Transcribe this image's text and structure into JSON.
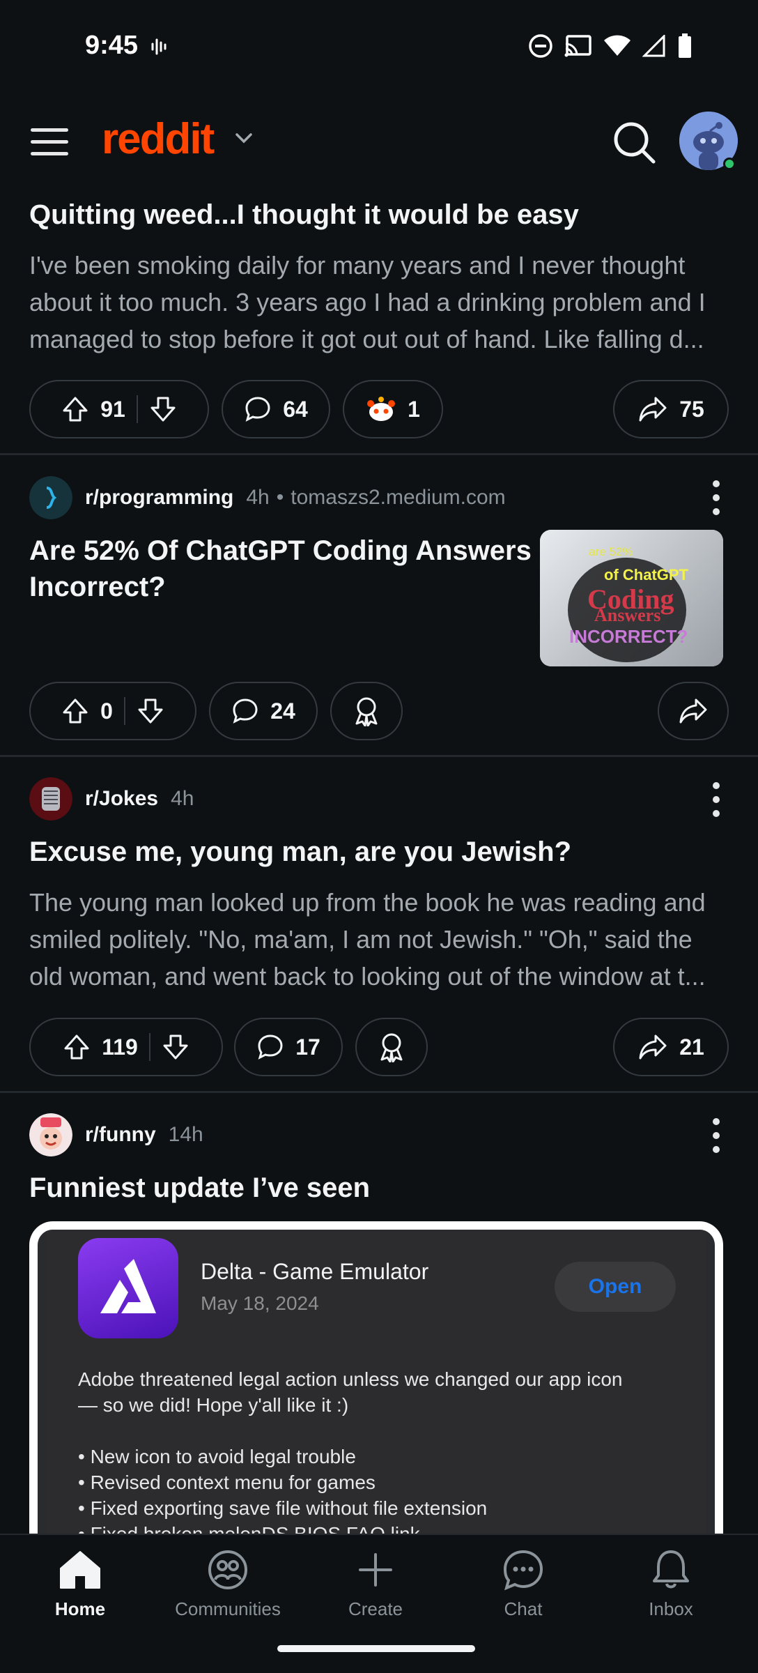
{
  "status_bar": {
    "time": "9:45"
  },
  "header": {
    "logo": "reddit"
  },
  "posts": [
    {
      "title": "Quitting weed...I thought it would be easy",
      "body_lines": [
        "I've been smoking daily for many years and I never thought",
        "about it too much. 3 years ago I had a drinking problem and I",
        "managed to stop before it got out out of hand. Like falling d..."
      ],
      "upvotes": "91",
      "comments": "64",
      "awards": "1",
      "shares": "75"
    },
    {
      "subreddit": "r/programming",
      "time": "4h",
      "domain": "tomaszs2.medium.com",
      "title_lines": [
        "Are 52% Of ChatGPT Coding Answers",
        "Incorrect?"
      ],
      "thumbnail_text": {
        "line1": "are 52%",
        "line2": "of ChatGPT",
        "line3": "Coding",
        "line4": "Answers",
        "line5": "INCORRECT?"
      },
      "upvotes": "0",
      "comments": "24"
    },
    {
      "subreddit": "r/Jokes",
      "time": "4h",
      "title": "Excuse me, young man, are you Jewish?",
      "body_lines": [
        "The young man looked up from the book he was reading and",
        "smiled politely. \"No, ma'am, I am not Jewish.\" \"Oh,\" said the",
        "old woman, and went back to looking out of the window at t..."
      ],
      "upvotes": "119",
      "comments": "17",
      "shares": "21"
    },
    {
      "subreddit": "r/funny",
      "time": "14h",
      "title": "Funniest update I’ve seen",
      "embed": {
        "app_name": "Delta - Game Emulator",
        "date": "May 18, 2024",
        "open_label": "Open",
        "text_line1": "Adobe threatened legal action unless we changed our app icon",
        "text_line2": "— so we did! Hope y'all like it :)",
        "bullets": [
          "• New icon to avoid legal trouble",
          "• Revised context menu for games",
          "• Fixed exporting save file without file extension",
          "• Fixed broken melonDS BIOS FAQ link"
        ]
      }
    }
  ],
  "bottom_nav": [
    {
      "label": "Home",
      "icon": "home-icon"
    },
    {
      "label": "Communities",
      "icon": "communities-icon"
    },
    {
      "label": "Create",
      "icon": "plus-icon"
    },
    {
      "label": "Chat",
      "icon": "chat-icon"
    },
    {
      "label": "Inbox",
      "icon": "bell-icon"
    }
  ],
  "colors": {
    "brand": "#ff4500",
    "background": "#0e1113",
    "muted": "#8b949a",
    "link": "#1a73e8"
  }
}
